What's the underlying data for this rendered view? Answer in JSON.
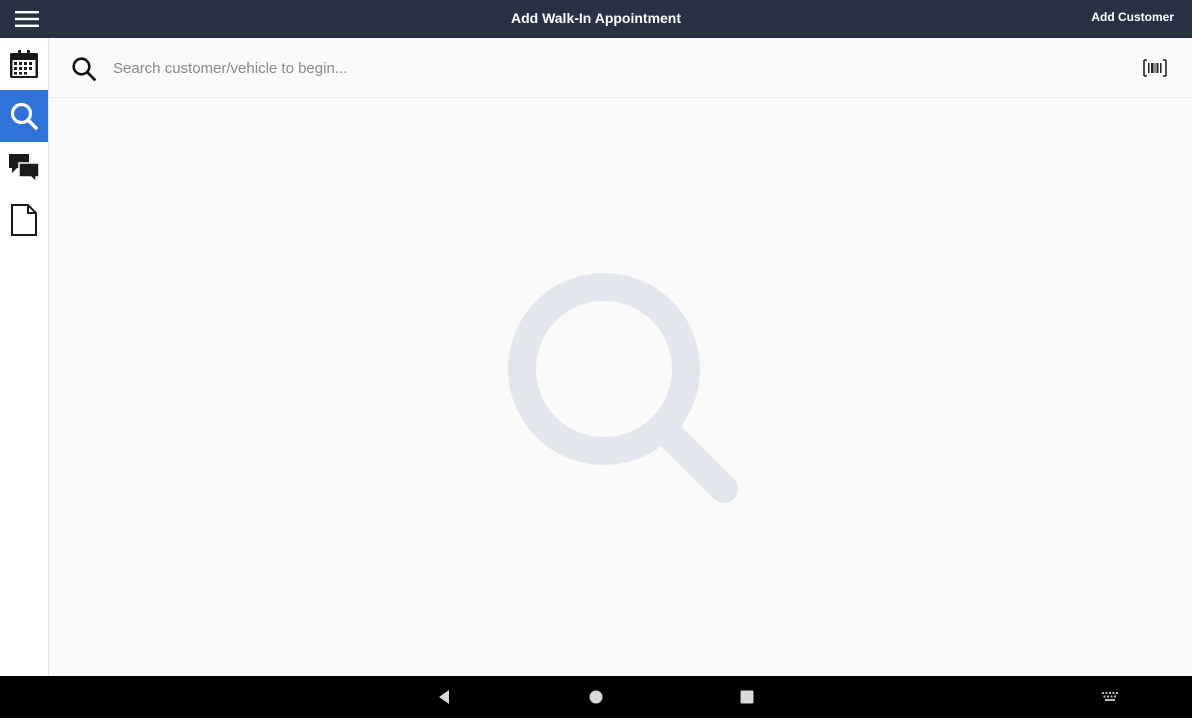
{
  "topbar": {
    "title": "Add Walk-In Appointment",
    "action_label": "Add Customer",
    "background": "#283244"
  },
  "sidebar": {
    "items": [
      {
        "icon": "calendar-icon",
        "active": false
      },
      {
        "icon": "search-icon",
        "active": true
      },
      {
        "icon": "chat-icon",
        "active": false
      },
      {
        "icon": "document-icon",
        "active": false
      }
    ],
    "active_color": "#2f73d8"
  },
  "search": {
    "placeholder": "Search customer/vehicle to begin...",
    "value": "",
    "scan_icon": "barcode-scan-icon"
  },
  "empty_state": {
    "icon": "magnifier-placeholder-icon"
  },
  "android_nav": {
    "buttons": [
      "back-icon",
      "home-icon",
      "recents-icon",
      "keyboard-icon"
    ]
  }
}
